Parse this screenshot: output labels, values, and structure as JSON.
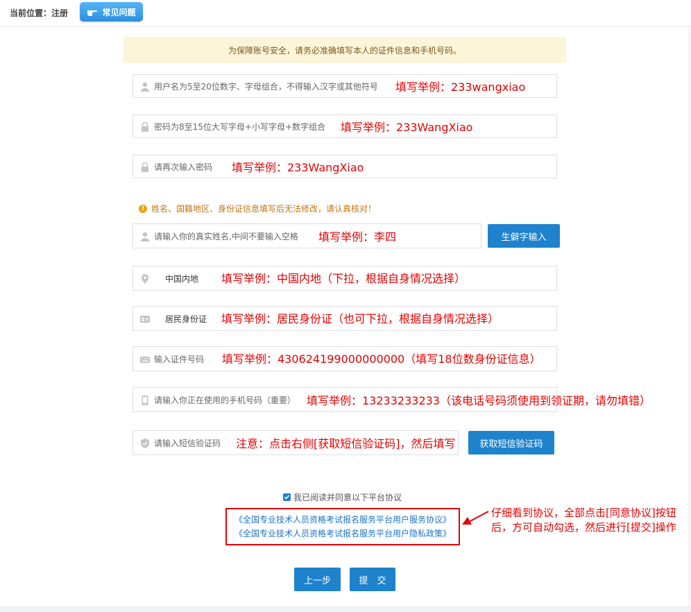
{
  "header": {
    "location_label": "当前位置：注册",
    "faq_label": "常见问题"
  },
  "notice": "为保障账号安全，请务必准确填写本人的证件信息和手机号码。",
  "fields": {
    "username": {
      "placeholder": "用户名为5至20位数字、字母组合，不得输入汉字或其他符号",
      "hint": "填写举例：233wangxiao",
      "icon": "user-icon"
    },
    "password": {
      "placeholder": "密码为8至15位大写字母+小写字母+数字组合",
      "hint": "填写举例：233WangXiao",
      "icon": "lock-icon"
    },
    "password_confirm": {
      "placeholder": "请再次输入密码",
      "hint": "填写举例：233WangXiao",
      "icon": "lock-icon"
    },
    "warning": "姓名、国籍地区、身份证信息填写后无法修改，请认真核对！",
    "real_name": {
      "placeholder": "请输入你的真实姓名,中间不要输入空格",
      "hint": "填写举例：李四",
      "icon": "user-icon",
      "button_label": "生僻字输入"
    },
    "region": {
      "value": "中国内地",
      "hint": "填写举例：中国内地（下拉，根据自身情况选择）",
      "icon": "location-pin-icon"
    },
    "id_type": {
      "value": "居民身份证",
      "hint": "填写举例：居民身份证（也可下拉，根据自身情况选择）",
      "icon": "id-card-icon"
    },
    "id_number": {
      "placeholder": "输入证件号码",
      "hint": "填写举例：430624199000000000（填写18位数身份证信息）",
      "icon": "keyboard-icon"
    },
    "phone": {
      "placeholder": "请输入你正在使用的手机号码（重要）",
      "hint": "填写举例：13233233233（该电话号码须使用到领证期，请勿填错）",
      "icon": "phone-icon"
    },
    "sms": {
      "placeholder": "请输入短信验证码",
      "hint": "注意：点击右侧[获取短信验证码]，然后填写",
      "icon": "shield-icon",
      "button_label": "获取短信验证码"
    }
  },
  "agreement": {
    "checkbox_label": "我已阅读并同意以下平台协议",
    "checked": true,
    "links": [
      "《全国专业技术人员资格考试报名服务平台用户服务协议》",
      "《全国专业技术人员资格考试报名服务平台用户隐私政策》"
    ],
    "annotation": "仔细看到协议，全部点击[同意协议]按钮后，方可自动勾选，然后进行[提交]操作"
  },
  "actions": {
    "prev_label": "上一步",
    "submit_label": "提　交"
  },
  "colors": {
    "primary": "#1e82cc",
    "annotation_red": "#e60000",
    "notice_bg": "#fcf5d9",
    "warning": "#c2750f"
  }
}
